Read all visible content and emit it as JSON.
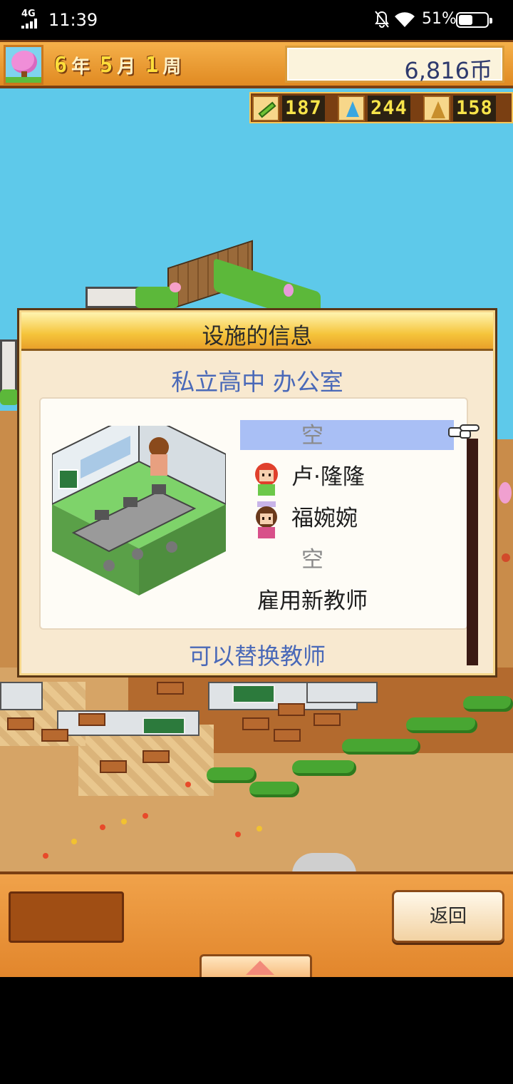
{
  "status_bar": {
    "network": "4G",
    "time": "11:39",
    "battery_percent_text": "51%",
    "battery_level": 0.51
  },
  "hud": {
    "year": "6",
    "year_unit": "年",
    "month": "5",
    "month_unit": "月",
    "week": "1",
    "week_unit": "周",
    "money": "6,816币",
    "resources": [
      {
        "icon": "pencil-icon",
        "value": "187"
      },
      {
        "icon": "flask-icon",
        "value": "244"
      },
      {
        "icon": "tower-icon",
        "value": "158"
      }
    ]
  },
  "dialog": {
    "title": "设施的信息",
    "subtitle": "私立高中 办公室",
    "slots": [
      {
        "label": "空",
        "selected": true,
        "empty": true
      },
      {
        "label": "卢·隆隆",
        "selected": false,
        "empty": false
      },
      {
        "label": "福婉婉",
        "selected": false,
        "empty": false
      },
      {
        "label": "空",
        "selected": false,
        "empty": true
      },
      {
        "label": "雇用新教师",
        "selected": false,
        "empty": false
      }
    ],
    "footer": "可以替换教师"
  },
  "bottom_bar": {
    "back_label": "返回"
  },
  "colors": {
    "sky": "#5ec9ea",
    "hud_orange": "#e08a22",
    "highlight_blue": "#a9bff5",
    "accent_text_blue": "#4a69b8"
  }
}
